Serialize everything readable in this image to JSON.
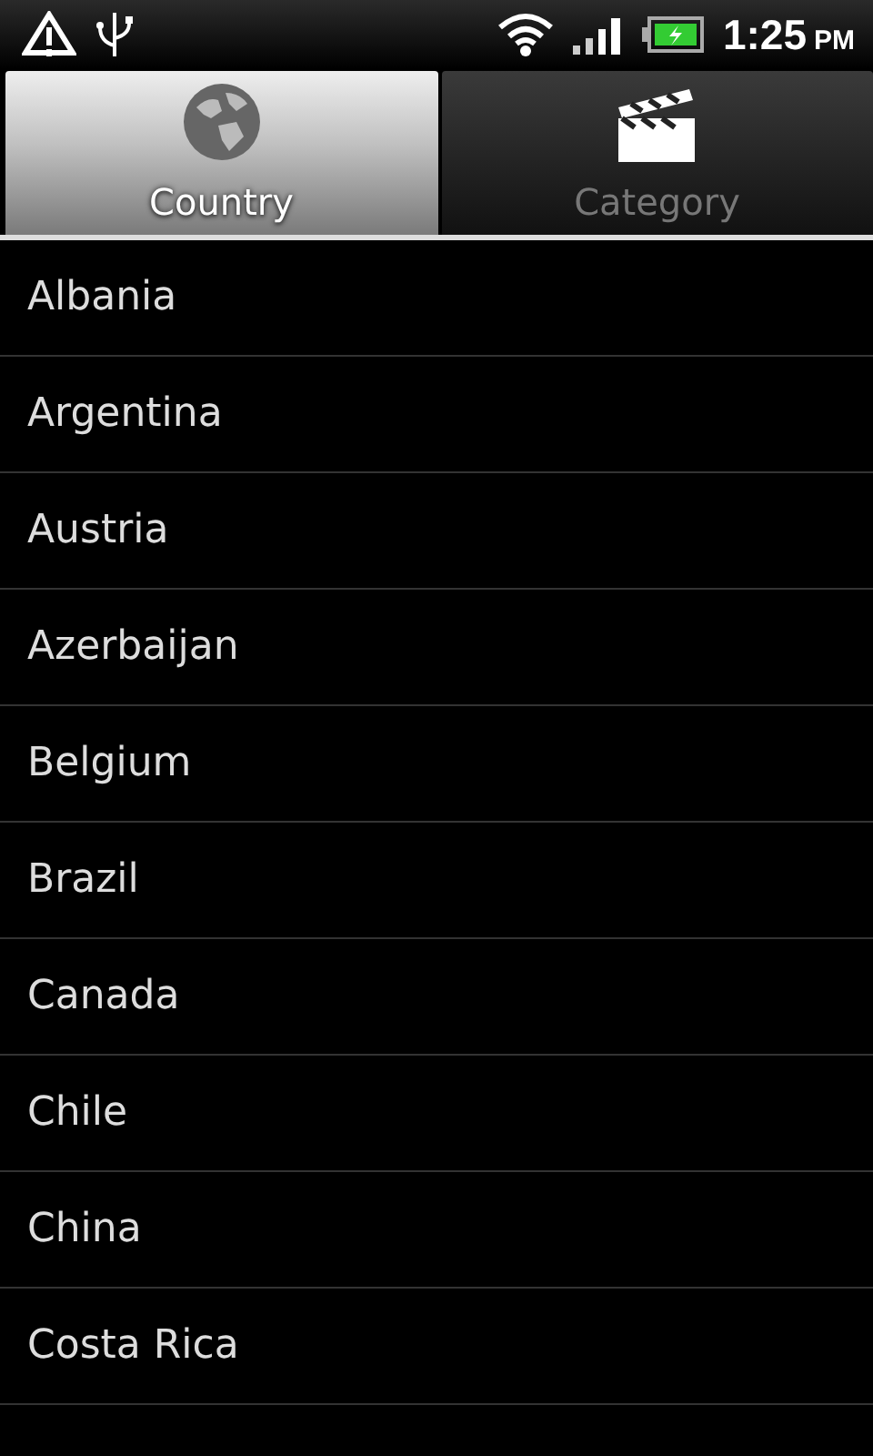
{
  "status_bar": {
    "time": "1:25",
    "period": "PM"
  },
  "tabs": [
    {
      "label": "Country",
      "kind": "globe",
      "selected": true
    },
    {
      "label": "Category",
      "kind": "clapper",
      "selected": false
    }
  ],
  "countries": [
    "Albania",
    "Argentina",
    "Austria",
    "Azerbaijan",
    "Belgium",
    "Brazil",
    "Canada",
    "Chile",
    "China",
    "Costa Rica"
  ]
}
